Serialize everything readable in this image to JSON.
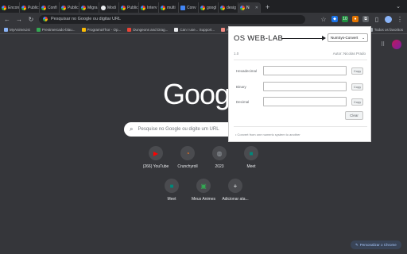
{
  "tabs": [
    {
      "label": "Encon",
      "icon": "google-favicon"
    },
    {
      "label": "Public",
      "icon": "google-favicon"
    },
    {
      "label": "Confi",
      "icon": "google-favicon"
    },
    {
      "label": "Public",
      "icon": "google-favicon"
    },
    {
      "label": "Migra",
      "icon": "google-favicon"
    },
    {
      "label": "Modi",
      "icon": "github-favicon"
    },
    {
      "label": "Public",
      "icon": "google-favicon"
    },
    {
      "label": "Interv",
      "icon": "google-favicon"
    },
    {
      "label": "multi",
      "icon": "google-favicon"
    },
    {
      "label": "Conv",
      "icon": "doc-favicon"
    },
    {
      "label": "googl",
      "icon": "google-favicon"
    },
    {
      "label": "desig",
      "icon": "google-favicon"
    },
    {
      "label": "N",
      "icon": "google-favicon",
      "active": true
    }
  ],
  "toolbar": {
    "omnibox_placeholder": "Pesquisar no Google ou digitar URL",
    "extension_badge": "10"
  },
  "bookmarks": [
    "MyAnimeList",
    "Prestmercado-blau...",
    "ProgramaThor - Op...",
    "Dungeons and Drag...",
    "Can I use... Support...",
    "Rent-a-Girlfr"
  ],
  "bookmarks_all": "Todos os favoritos",
  "google_logo": "Google",
  "search": {
    "placeholder": "Pesquise no Google ou digite um URL"
  },
  "shortcuts": [
    {
      "label": "(266) YouTube",
      "icon": "youtube-icon",
      "color": "#ff0000"
    },
    {
      "label": "Crunchyroll",
      "icon": "crunchyroll-icon",
      "color": "#f47521"
    },
    {
      "label": "2023",
      "icon": "globe-icon",
      "color": "#9aa0a6"
    },
    {
      "label": "Meet",
      "icon": "meet-icon",
      "color": "#00897b"
    },
    {
      "label": "Meet",
      "icon": "meet-icon",
      "color": "#00897b"
    },
    {
      "label": "Meus Animes",
      "icon": "anime-icon",
      "color": "#34a853"
    },
    {
      "label": "Adicionar ata...",
      "icon": "plus-icon",
      "color": "#e8eaed"
    }
  ],
  "customize_label": "Personalizar o Chrome",
  "popup": {
    "title": "OS WEB-LAB",
    "select_value": "NumSys-Convert",
    "version": "1.0",
    "author": "Autor: Nicolas Prado",
    "fields": [
      {
        "label": "Hexadecimal",
        "value": "",
        "copy": "Copy"
      },
      {
        "label": "Binary",
        "value": "",
        "copy": "Copy"
      },
      {
        "label": "Decimal",
        "value": "",
        "copy": "Copy"
      }
    ],
    "clear_label": "Clear",
    "note": "• Convert from one numeric system to another"
  }
}
